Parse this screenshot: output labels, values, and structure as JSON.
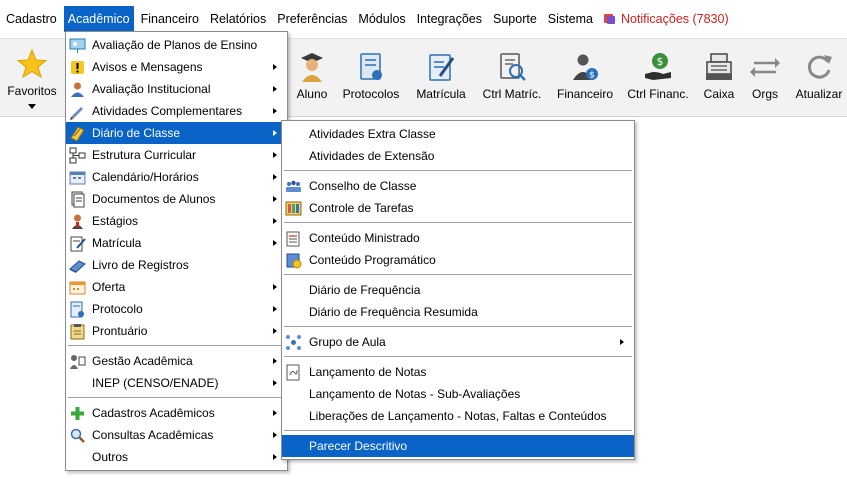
{
  "menubar": {
    "items": [
      "Cadastro",
      "Acadêmico",
      "Financeiro",
      "Relatórios",
      "Preferências",
      "Módulos",
      "Integrações",
      "Suporte",
      "Sistema"
    ],
    "notifications": "Notificações (7830)"
  },
  "toolbar": {
    "favoritos": "Favoritos",
    "aluno": "Aluno",
    "protocolos": "Protocolos",
    "matricula": "Matrícula",
    "ctrl_matric": "Ctrl Matríc.",
    "financeiro": "Financeiro",
    "ctrl_financ": "Ctrl Financ.",
    "caixa": "Caixa",
    "orgs": "Orgs",
    "atualizar": "Atualizar"
  },
  "academico_menu": {
    "items": [
      "Avaliação de Planos de Ensino",
      "Avisos e Mensagens",
      "Avaliação Institucional",
      "Atividades Complementares",
      "Diário de Classe",
      "Estrutura Curricular",
      "Calendário/Horários",
      "Documentos de Alunos",
      "Estágios",
      "Matrícula",
      "Livro de Registros",
      "Oferta",
      "Protocolo",
      "Prontuário",
      "Gestão Acadêmica",
      "INEP (CENSO/ENADE)",
      "Cadastros Acadêmicos",
      "Consultas Acadêmicas",
      "Outros"
    ]
  },
  "diario_menu": {
    "items": [
      "Atividades Extra Classe",
      "Atividades de Extensão",
      "Conselho de Classe",
      "Controle de Tarefas",
      "Conteúdo Ministrado",
      "Conteúdo Programático",
      "Diário de Frequência",
      "Diário de Frequência Resumida",
      "Grupo de Aula",
      "Lançamento de Notas",
      "Lançamento de Notas - Sub-Avaliações",
      "Liberações de Lançamento - Notas, Faltas e Conteúdos",
      "Parecer Descritivo"
    ]
  },
  "colors": {
    "highlight": "#0a64c8",
    "notification": "#cc1f1f",
    "toolbar_bg": "#f2f2f2"
  }
}
